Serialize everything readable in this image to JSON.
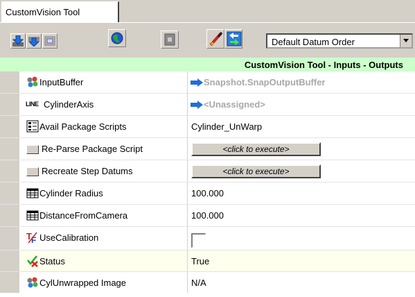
{
  "tab": {
    "label": "CustomVision Tool"
  },
  "toolbar": {
    "buttons": [
      {
        "icon": "download-blue-icon"
      },
      {
        "icon": "download-gray-icon"
      },
      {
        "icon": "image-frame-icon"
      },
      {
        "icon": "globe-icon"
      },
      {
        "icon": "document-icon"
      },
      {
        "icon": "brush-icon"
      },
      {
        "icon": "blue-arrows-icon"
      }
    ],
    "datum_order": {
      "selected": "Default Datum Order"
    }
  },
  "header": {
    "title": "CustomVision Tool - Inputs - Outputs"
  },
  "rows": [
    {
      "name": "InputBuffer",
      "icon": "buffer-link-icon",
      "value": "Snapshot.SnapOutputBuffer"
    },
    {
      "name": "CylinderAxis",
      "icon": "line-icon",
      "icon_text": "LINE",
      "value": "<Unassigned>"
    },
    {
      "name": "Avail Package Scripts",
      "icon": "script-list-icon",
      "value": "Cylinder_UnWarp"
    },
    {
      "name": "Re-Parse Package Script",
      "icon": "button-icon",
      "value": "<click to execute>"
    },
    {
      "name": "Recreate Step Datums",
      "icon": "button-icon",
      "value": "<click to execute>"
    },
    {
      "name": "Cylinder Radius",
      "icon": "numeric-grid-icon",
      "value": "100.000"
    },
    {
      "name": "DistanceFromCamera",
      "icon": "numeric-grid-icon",
      "value": "100.000"
    },
    {
      "name": "UseCalibration",
      "icon": "true-false-icon",
      "value": false
    },
    {
      "name": "Status",
      "icon": "status-check-icon",
      "value": "True"
    },
    {
      "name": "CylUnwrapped Image",
      "icon": "image-link-icon",
      "value": "N/A"
    }
  ],
  "colors": {
    "header_bg": "#ccffcc",
    "chrome": "#d4d0c8",
    "link_arrow": "#1e6fd9"
  }
}
